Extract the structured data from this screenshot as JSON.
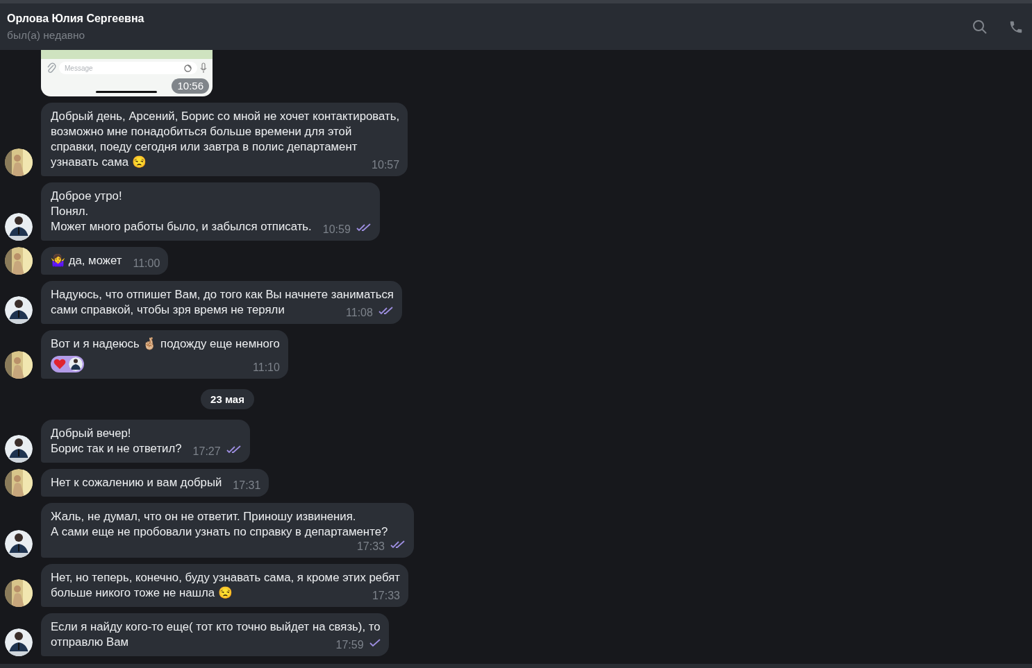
{
  "header": {
    "name": "Орлова Юлия Сергеевна",
    "status": "был(а) недавно"
  },
  "messages": [
    {
      "kind": "image",
      "placeholder": "Message",
      "time": "10:56"
    },
    {
      "kind": "text",
      "outgoing": false,
      "lines": [
        "Добрый день, Арсений, Борис со мной не хочет контактировать,",
        "возможно мне понадобиться больше времени для этой",
        "справки, поеду сегодня или завтра в полис департамент",
        "узнавать сама 😒"
      ],
      "time": "10:57"
    },
    {
      "kind": "text",
      "outgoing": true,
      "lines": [
        "Доброе утро!",
        "Понял.",
        "Может много работы было, и забылся отписать."
      ],
      "time": "10:59",
      "read": true
    },
    {
      "kind": "text",
      "outgoing": false,
      "lines": [
        "🤷‍♀️ да, может"
      ],
      "time": "11:00"
    },
    {
      "kind": "text",
      "outgoing": true,
      "lines": [
        "Надуюсь, что отпишет Вам, до того как Вы начнете заниматься",
        "сами справкой, чтобы зря время не теряли"
      ],
      "time": "11:08",
      "read": true
    },
    {
      "kind": "text",
      "outgoing": false,
      "lines": [
        "Вот и я надеюсь 🤞🏼 подожду еще немного"
      ],
      "time": "11:10",
      "reactions": [
        {
          "kind": "heart"
        }
      ]
    },
    {
      "kind": "date",
      "label": "23 мая"
    },
    {
      "kind": "text",
      "outgoing": true,
      "lines": [
        "Добрый вечер!",
        "Борис так и не ответил?"
      ],
      "time": "17:27",
      "read": true
    },
    {
      "kind": "text",
      "outgoing": false,
      "lines": [
        "Нет к сожалению и вам добрый"
      ],
      "time": "17:31"
    },
    {
      "kind": "text",
      "outgoing": true,
      "lines": [
        "Жаль, не думал, что он не ответит. Приношу извинения.",
        "А сами еще не пробовали узнать по справку в департаменте?"
      ],
      "time": "17:33",
      "read": true
    },
    {
      "kind": "text",
      "outgoing": false,
      "lines": [
        "Нет, но теперь, конечно, буду узнавать сама, я кроме этих ребят",
        "больше никого тоже не нашла 😒"
      ],
      "time": "17:33"
    },
    {
      "kind": "text",
      "outgoing": true,
      "lines": [
        "Если я найду кого-то еще( тот кто точно выйдет на связь), то",
        "отправлю Вам"
      ],
      "time": "17:59",
      "read": false
    }
  ]
}
